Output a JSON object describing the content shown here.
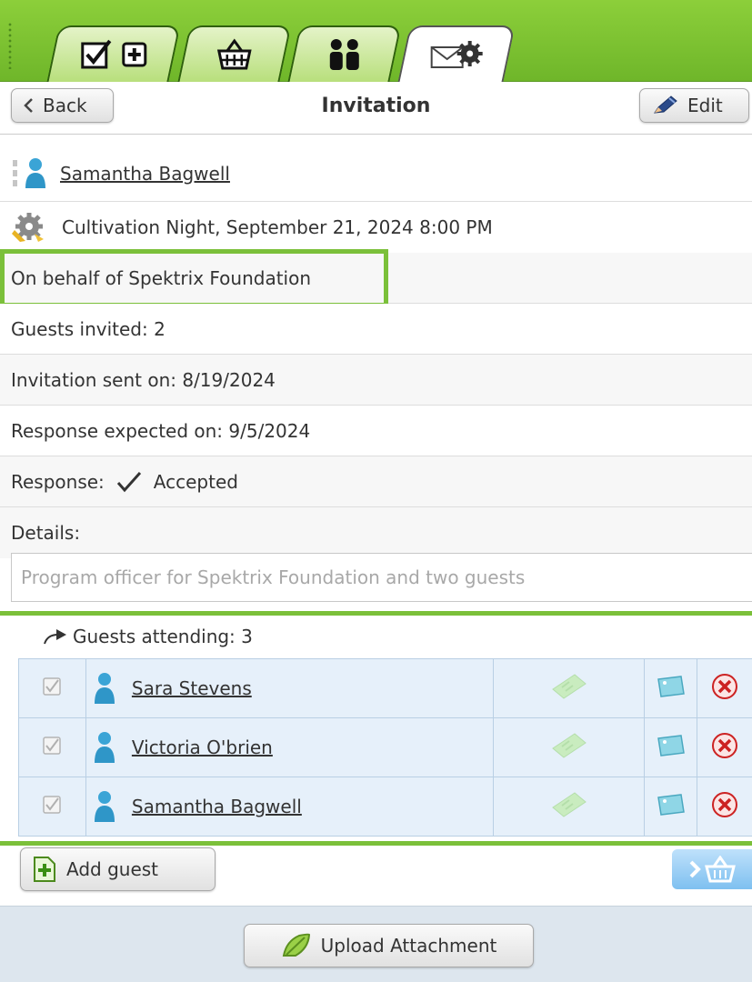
{
  "header": {
    "back_label": "Back",
    "title": "Invitation",
    "edit_label": "Edit"
  },
  "tabs": [
    {
      "icons": [
        "checkbox-icon",
        "plus-box-icon"
      ]
    },
    {
      "icons": [
        "basket-icon"
      ]
    },
    {
      "icons": [
        "people-icon"
      ]
    },
    {
      "icons": [
        "envelope-gear-icon"
      ],
      "active": true
    }
  ],
  "details": {
    "person_name": "Samantha Bagwell",
    "event": "Cultivation Night, September 21, 2024 8:00 PM",
    "on_behalf": "On behalf of Spektrix Foundation",
    "guests_invited": "Guests invited: 2",
    "invitation_sent": "Invitation sent on: 8/19/2024",
    "response_expected": "Response expected on: 9/5/2024",
    "response_label": "Response:",
    "response_value": "Accepted",
    "details_label": "Details:",
    "details_text": "Program officer for Spektrix Foundation and two guests"
  },
  "guests": {
    "attending_label": "Guests attending: 3",
    "rows": [
      {
        "name": "Sara Stevens",
        "checked": true
      },
      {
        "name": "Victoria O'brien",
        "checked": true
      },
      {
        "name": "Samantha Bagwell",
        "checked": true
      }
    ]
  },
  "footer": {
    "add_guest_label": "Add guest",
    "upload_label": "Upload Attachment"
  },
  "colors": {
    "brand_green": "#7bc03a",
    "tab_border": "#2f5f0f",
    "table_bg": "#e6f0fa",
    "delete_red": "#cc2222"
  }
}
